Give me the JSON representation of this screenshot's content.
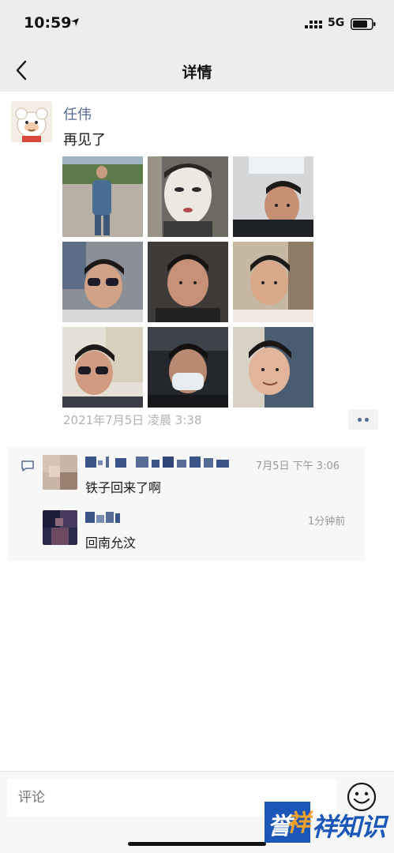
{
  "status_bar": {
    "time": "10:59",
    "network": "5G",
    "icons": [
      "location-arrow-icon",
      "signal-dots-icon",
      "battery-icon"
    ]
  },
  "nav": {
    "title": "详情",
    "back_icon": "chevron-left-icon"
  },
  "post": {
    "author": "任伟",
    "text": "再见了",
    "time": "2021年7月5日 凌晨 3:38",
    "photo_count": 9,
    "more_icon": "two-dots-icon"
  },
  "comments": {
    "icon": "comment-bubble-icon",
    "items": [
      {
        "time": "7月5日 下午 3:06",
        "text": "铁子回来了啊"
      },
      {
        "time": "1分钟前",
        "text": "回南允汶"
      }
    ]
  },
  "composer": {
    "placeholder": "评论",
    "emoji_icon": "smiley-face-icon"
  },
  "watermark": {
    "text": "誉祥知识",
    "char_first": "誉",
    "char_second": "祥",
    "text_rest": "祥知识"
  },
  "colors": {
    "bar_bg": "#ededed",
    "link_blue": "#576b95",
    "meta_gray": "#b2b2b2",
    "comment_bg": "#f7f7f7",
    "watermark_blue": "#1a57b8",
    "watermark_orange": "#f0a12a"
  }
}
